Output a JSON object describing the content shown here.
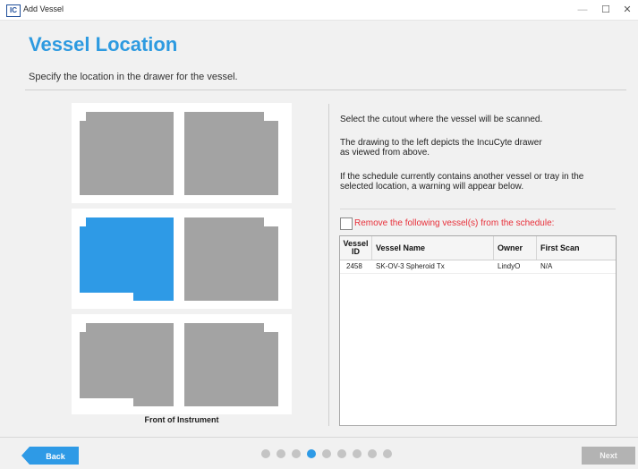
{
  "window": {
    "logo_text": "IC",
    "title": "Add Vessel",
    "minimize_glyph": "—",
    "maximize_glyph": "☐",
    "close_glyph": "✕"
  },
  "page": {
    "title": "Vessel Location",
    "subtitle": "Specify the location in the drawer for the vessel."
  },
  "drawer": {
    "front_label": "Front of Instrument",
    "selected_cutout": "middle-left",
    "colors": {
      "cutout": "#a3a3a3",
      "selected": "#2e9ae6",
      "tray": "#ffffff"
    }
  },
  "info": {
    "line1": "Select the cutout where the vessel will be scanned.",
    "line2a": "The drawing to the left depicts the IncuCyte drawer",
    "line2b": "as viewed from above.",
    "line3a": "If the schedule currently contains another vessel or tray in the",
    "line3b": "selected location, a warning will appear below."
  },
  "remove_option": {
    "label": "Remove the following vessel(s) from the schedule:",
    "checked": false
  },
  "table": {
    "headers": {
      "id_line1": "Vessel",
      "id_line2": "ID",
      "name": "Vessel Name",
      "owner": "Owner",
      "first_scan": "First Scan"
    },
    "rows": [
      {
        "id": "2458",
        "name": "SK-OV-3 Spheroid Tx",
        "owner": "LindyO",
        "first_scan": "N/A"
      }
    ]
  },
  "footer": {
    "back_label": "Back",
    "next_label": "Next",
    "step_total": 9,
    "step_current": 4,
    "colors": {
      "back": "#2e9ae6",
      "next": "#b3b3b3",
      "dot_active": "#2e9ae6",
      "dot_inactive": "#c4c4c4"
    }
  }
}
